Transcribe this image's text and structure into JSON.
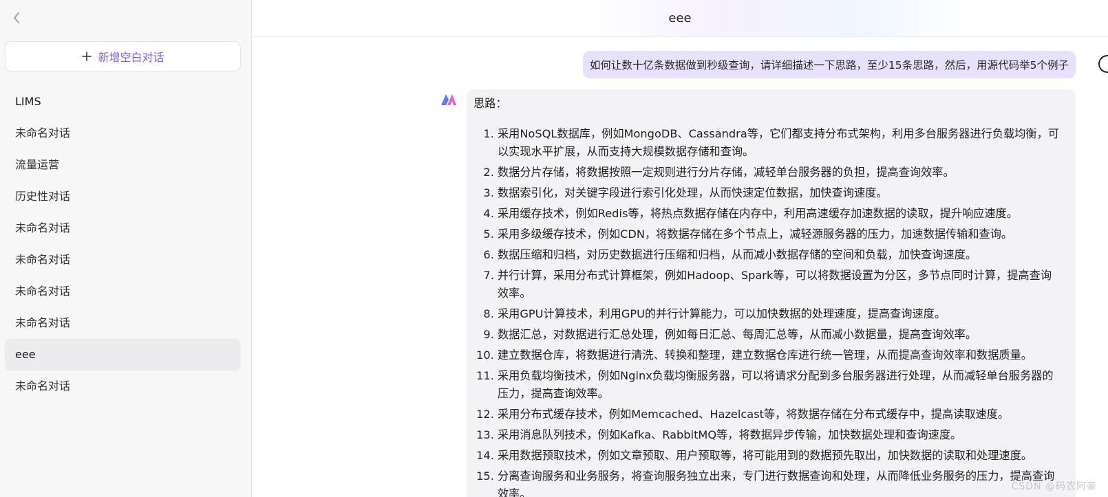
{
  "sidebar": {
    "back_icon": "chevron-left-icon",
    "new_chat": {
      "icon": "plus-icon",
      "label": "新增空白对话",
      "color": "#7b5cf0"
    },
    "conversations": [
      {
        "label": "LIMS"
      },
      {
        "label": "未命名对话"
      },
      {
        "label": "流量运营"
      },
      {
        "label": "历史性对话"
      },
      {
        "label": "未命名对话"
      },
      {
        "label": "未命名对话"
      },
      {
        "label": "未命名对话"
      },
      {
        "label": "未命名对话"
      },
      {
        "label": "eee",
        "active": true
      },
      {
        "label": "未命名对话"
      }
    ]
  },
  "header": {
    "title": "eee"
  },
  "chat": {
    "user_message": "如何让数十亿条数据做到秒级查询，请详细描述一下思路，至少15条思路，然后，用源代码举5个例子",
    "bot_logo": "assistant-logo-icon",
    "bot_heading": "思路：",
    "bot_points": [
      "采用NoSQL数据库，例如MongoDB、Cassandra等，它们都支持分布式架构，利用多台服务器进行负载均衡，可以实现水平扩展，从而支持大规模数据存储和查询。",
      "数据分片存储，将数据按照一定规则进行分片存储，减轻单台服务器的负担，提高查询效率。",
      "数据索引化，对关键字段进行索引化处理，从而快速定位数据，加快查询速度。",
      "采用缓存技术，例如Redis等，将热点数据存储在内存中，利用高速缓存加速数据的读取，提升响应速度。",
      "采用多级缓存技术，例如CDN，将数据存储在多个节点上，减轻源服务器的压力，加速数据传输和查询。",
      "数据压缩和归档，对历史数据进行压缩和归档，从而减小数据存储的空间和负载，加快查询速度。",
      "并行计算，采用分布式计算框架，例如Hadoop、Spark等，可以将数据设置为分区，多节点同时计算，提高查询效率。",
      "采用GPU计算技术，利用GPU的并行计算能力，可以加快数据的处理速度，提高查询速度。",
      "数据汇总，对数据进行汇总处理，例如每日汇总、每周汇总等，从而减小数据量，提高查询效率。",
      "建立数据仓库，将数据进行清洗、转换和整理，建立数据仓库进行统一管理，从而提高查询效率和数据质量。",
      "采用负载均衡技术，例如Nginx负载均衡服务器，可以将请求分配到多台服务器进行处理，从而减轻单台服务器的压力，提高查询效率。",
      "采用分布式缓存技术，例如Memcached、Hazelcast等，将数据存储在分布式缓存中，提高读取速度。",
      "采用消息队列技术，例如Kafka、RabbitMQ等，将数据异步传输，加快数据处理和查询速度。",
      "采用数据预取技术，例如文章预取、用户预取等，将可能用到的数据预先取出，加快数据的读取和处理速度。",
      "分离查询服务和业务服务，将查询服务独立出来，专门进行数据查询和处理，从而降低业务服务的压力，提高查询效率。"
    ]
  },
  "watermark": "CSDN @码农阿豪"
}
